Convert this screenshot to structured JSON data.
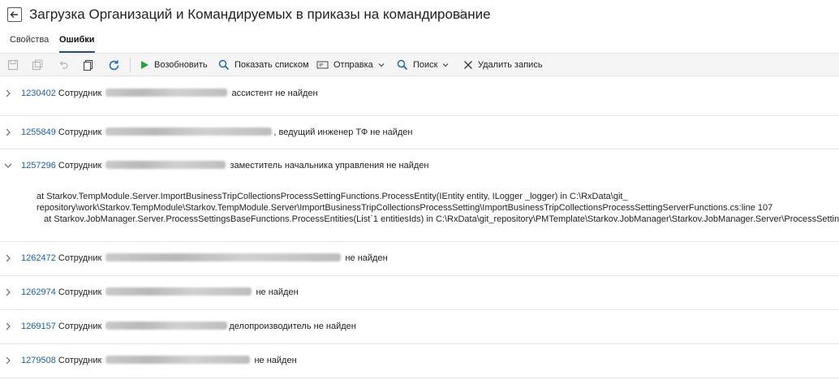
{
  "header": {
    "title": "Загрузка Организаций и Командируемых в приказы на командирование"
  },
  "tabs": [
    {
      "label": "Свойства"
    },
    {
      "label": "Ошибки"
    }
  ],
  "toolbar": {
    "resume_label": "Возобновить",
    "show_list_label": "Показать списком",
    "send_label": "Отправка",
    "search_label": "Поиск",
    "delete_label": "Удалить запись"
  },
  "rows": [
    {
      "id": "1230402",
      "prefix": "Сотрудник",
      "suffix": "ассистент не найден",
      "expanded": false
    },
    {
      "id": "1255849",
      "prefix": "Сотрудник",
      "suffix": ", ведущий инженер ТФ не найден",
      "expanded": false
    },
    {
      "id": "1257296",
      "prefix": "Сотрудник",
      "suffix": "заместитель начальника управления не найден",
      "expanded": true,
      "details": "at Starkov.TempModule.Server.ImportBusinessTripCollectionsProcessSettingFunctions.ProcessEntity(IEntity entity, ILogger _logger) in C:\\RxData\\git_\nrepository\\work\\Starkov.TempModule\\Starkov.TempModule.Server\\ImportBusinessTripCollectionsProcessSetting\\ImportBusinessTripCollectionsProcessSettingServerFunctions.cs:line 107\n   at Starkov.JobManager.Server.ProcessSettingsBaseFunctions.ProcessEntities(List`1 entitiesIds) in C:\\RxData\\git_repository\\PMTemplate\\Starkov.JobManager\\Starkov.JobManager.Server\\ProcessSettingsBase"
    },
    {
      "id": "1262472",
      "prefix": "Сотрудник",
      "suffix": "не найден",
      "expanded": false
    },
    {
      "id": "1262974",
      "prefix": "Сотрудник",
      "suffix": "не найден",
      "expanded": false
    },
    {
      "id": "1269157",
      "prefix": "Сотрудник",
      "suffix": "делопроизводитель не найден",
      "expanded": false
    },
    {
      "id": "1279508",
      "prefix": "Сотрудник",
      "suffix": "не найден",
      "expanded": false
    }
  ],
  "colors": {
    "link": "#1a5fa8",
    "resume_icon": "#2e9e3e",
    "refresh_icon": "#1f6fc0",
    "active_tab_underline": "#1e4e8c"
  }
}
